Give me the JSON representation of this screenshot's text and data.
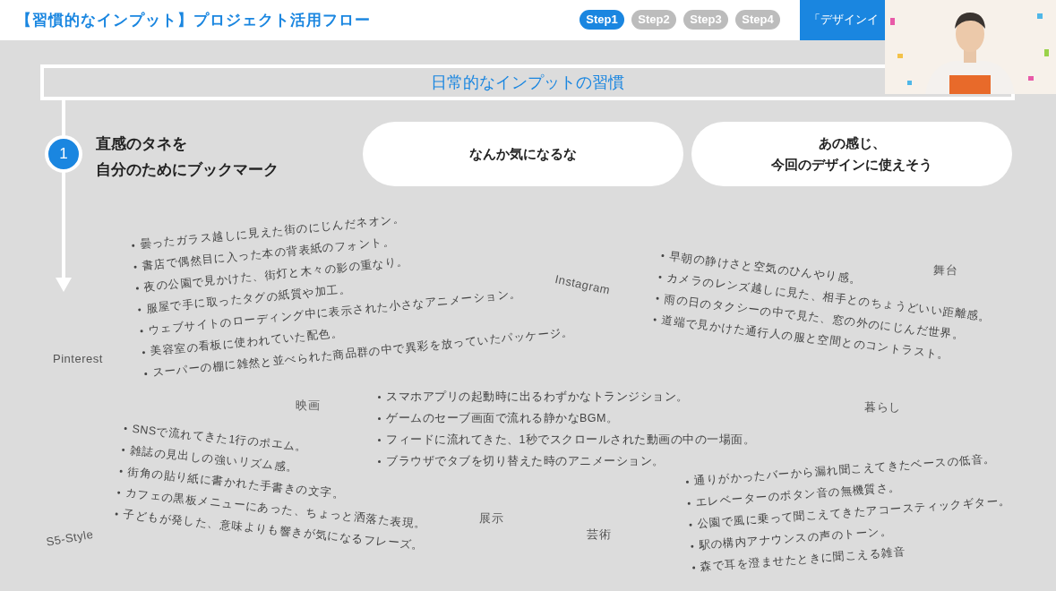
{
  "header": {
    "title": "【習慣的なインプット】プロジェクト活用フロー",
    "steps": [
      {
        "label": "Step1",
        "selected": true
      },
      {
        "label": "Step2",
        "selected": false
      },
      {
        "label": "Step3",
        "selected": false
      },
      {
        "label": "Step4",
        "selected": false
      }
    ],
    "cta": "「デザインイ"
  },
  "banner": "日常的なインプットの習慣",
  "step": {
    "number": "1",
    "lines": [
      "直感のタネを",
      "自分のためにブックマーク"
    ]
  },
  "bubbles": [
    {
      "lines": [
        "なんか気になるな"
      ]
    },
    {
      "lines": [
        "あの感じ、",
        "今回のデザインに使えそう"
      ]
    }
  ],
  "tags": [
    "Pinterest",
    "Instagram",
    "舞台",
    "映画",
    "暮らし",
    "S5-Style",
    "展示",
    "芸術"
  ],
  "lists": [
    {
      "items": [
        "曇ったガラス越しに見えた街のにじんだネオン。",
        "書店で偶然目に入った本の背表紙のフォント。",
        "夜の公園で見かけた、街灯と木々の影の重なり。",
        "服屋で手に取ったタグの紙質や加工。",
        "ウェブサイトのローディング中に表示された小さなアニメーション。",
        "美容室の看板に使われていた配色。",
        "スーパーの棚に雑然と並べられた商品群の中で異彩を放っていたパッケージ。"
      ]
    },
    {
      "items": [
        "早朝の静けさと空気のひんやり感。",
        "カメラのレンズ越しに見た、相手とのちょうどいい距離感。",
        "雨の日のタクシーの中で見た、窓の外のにじんだ世界。",
        "道端で見かけた通行人の服と空間とのコントラスト。"
      ]
    },
    {
      "items": [
        "スマホアプリの起動時に出るわずかなトランジション。",
        "ゲームのセーブ画面で流れる静かなBGM。",
        "フィードに流れてきた、1秒でスクロールされた動画の中の一場面。",
        "ブラウザでタブを切り替えた時のアニメーション。"
      ]
    },
    {
      "items": [
        "SNSで流れてきた1行のポエム。",
        "雑誌の見出しの強いリズム感。",
        "街角の貼り紙に書かれた手書きの文字。",
        "カフェの黒板メニューにあった、ちょっと洒落た表現。",
        "子どもが発した、意味よりも響きが気になるフレーズ。"
      ]
    },
    {
      "items": [
        "通りがかったバーから漏れ聞こえてきたベースの低音。",
        "エレベーターのボタン音の無機質さ。",
        "公園で風に乗って聞こえてきたアコースティックギター。",
        "駅の構内アナウンスの声のトーン。",
        "森で耳を澄ませたときに聞こえる雑音"
      ]
    }
  ]
}
